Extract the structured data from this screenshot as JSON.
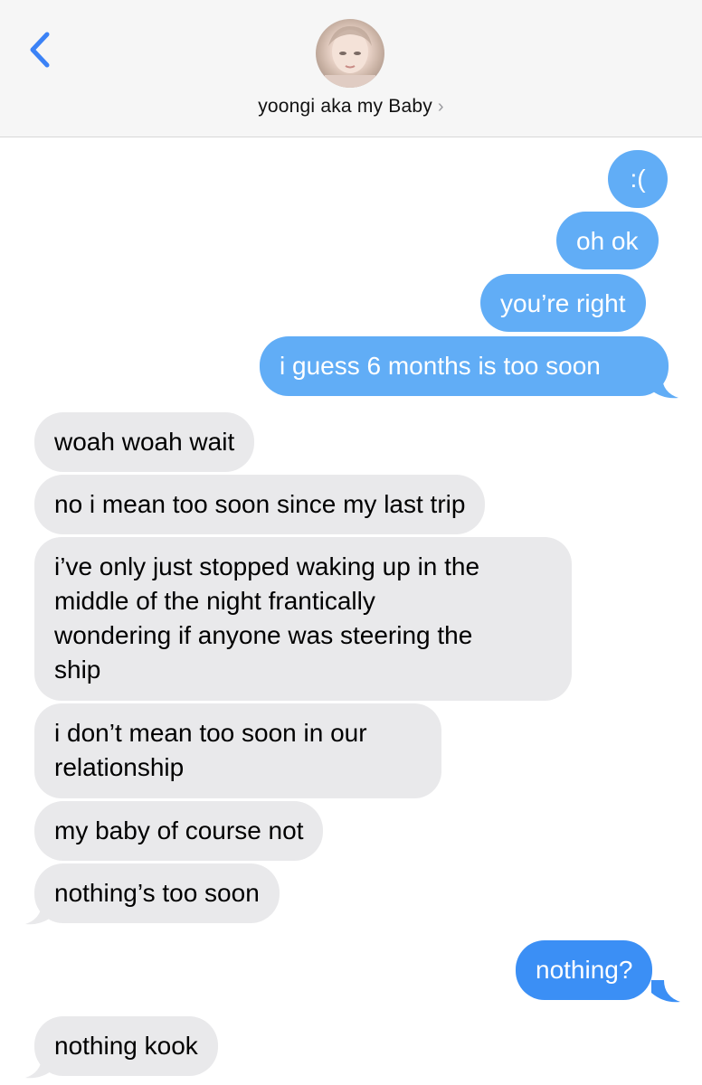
{
  "header": {
    "contact_name": "yoongi aka my Baby",
    "chevron": "›",
    "back_icon": "chevron-left-icon",
    "accent_color": "#3b82f6"
  },
  "messages": [
    {
      "from": "me",
      "text": ":("
    },
    {
      "from": "me",
      "text": "oh ok"
    },
    {
      "from": "me",
      "text": "you’re right"
    },
    {
      "from": "me",
      "text": "i guess 6 months is too soon"
    },
    {
      "from": "them",
      "text": "woah woah wait"
    },
    {
      "from": "them",
      "text": "no i mean too soon since my last trip"
    },
    {
      "from": "them",
      "lines": [
        "i’ve only just stopped waking up in the",
        "middle of the night frantically",
        "wondering if anyone was steering the",
        "ship"
      ]
    },
    {
      "from": "them",
      "lines": [
        "i don’t mean too soon in our",
        "relationship"
      ]
    },
    {
      "from": "them",
      "text": "my baby of course not"
    },
    {
      "from": "them",
      "text": "nothing’s too soon"
    },
    {
      "from": "me",
      "text": "nothing?"
    },
    {
      "from": "them",
      "text": "nothing kook"
    }
  ],
  "colors": {
    "sent_bubble": "#61adf6",
    "sent_bubble_latest": "#3b8ff5",
    "received_bubble": "#e9e9eb"
  }
}
